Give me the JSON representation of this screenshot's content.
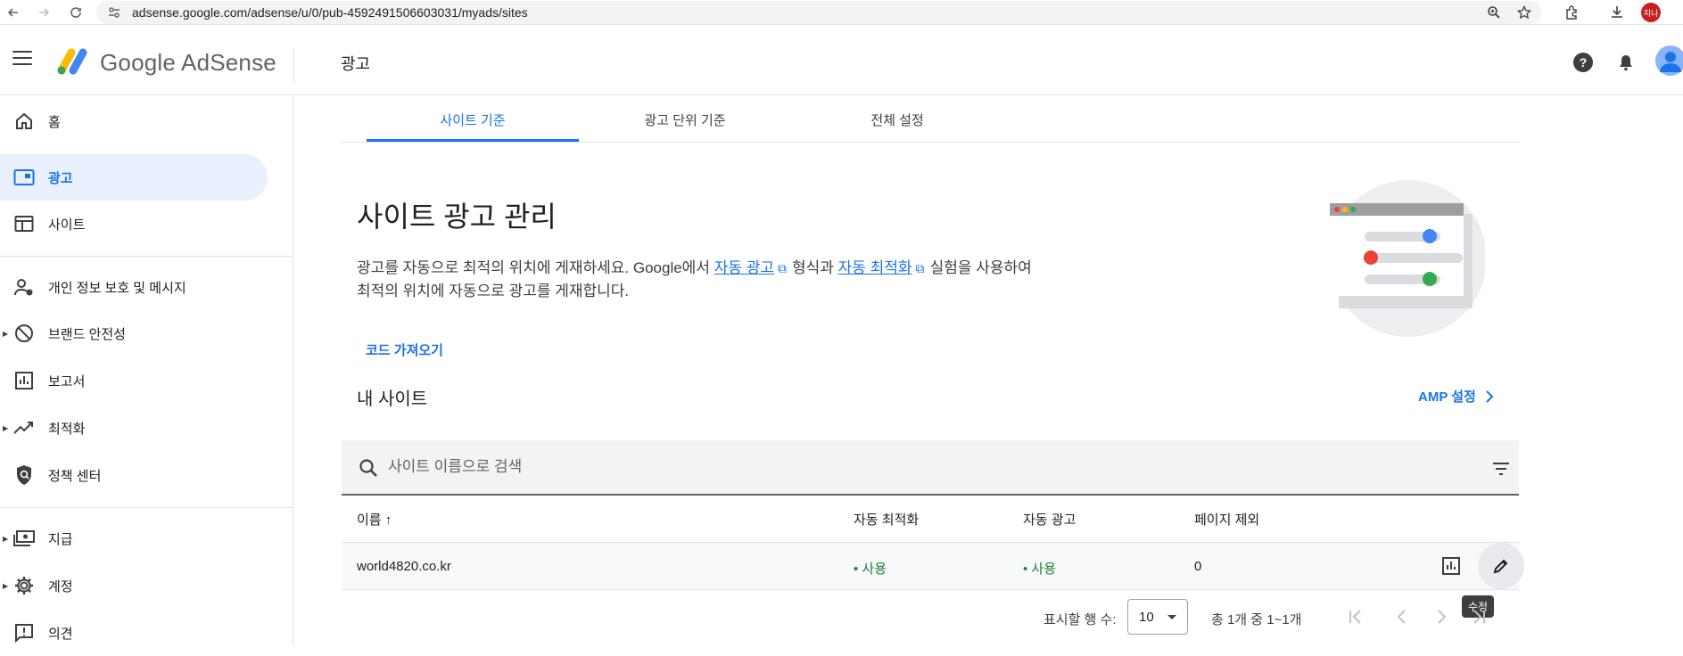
{
  "browser": {
    "url": "adsense.google.com/adsense/u/0/pub-4592491506603031/myads/sites",
    "profile_initials": "지나"
  },
  "header": {
    "product_name": "Google AdSense",
    "page_title": "광고"
  },
  "sidebar": {
    "items": [
      {
        "label": "홈",
        "icon": "home-icon"
      },
      {
        "label": "광고",
        "icon": "ads-icon",
        "active": true
      },
      {
        "label": "사이트",
        "icon": "sites-icon"
      },
      {
        "label": "개인 정보 보호 및 메시지",
        "icon": "privacy-messaging-icon"
      },
      {
        "label": "브랜드 안전성",
        "icon": "block-icon",
        "expandable": true
      },
      {
        "label": "보고서",
        "icon": "reports-icon"
      },
      {
        "label": "최적화",
        "icon": "trending-up-icon",
        "expandable": true
      },
      {
        "label": "정책 센터",
        "icon": "policy-shield-icon"
      },
      {
        "label": "지급",
        "icon": "payments-icon",
        "expandable": true
      },
      {
        "label": "계정",
        "icon": "settings-icon",
        "expandable": true
      },
      {
        "label": "의견",
        "icon": "feedback-icon"
      }
    ]
  },
  "tabs": [
    {
      "label": "사이트 기준",
      "active": true
    },
    {
      "label": "광고 단위 기준"
    },
    {
      "label": "전체 설정"
    }
  ],
  "hero": {
    "title": "사이트 광고 관리",
    "desc_part1": "광고를 자동으로 최적의 위치에 게재하세요. Google에서 ",
    "link_auto_ads": "자동 광고",
    "desc_part2": "형식과 ",
    "link_auto_opt": "자동 최적화",
    "desc_part3": "실험을 사용하여",
    "desc_line2": "최적의 위치에 자동으로 광고를 게재합니다.",
    "code_button": "코드 가져오기"
  },
  "sites": {
    "section_title": "내 사이트",
    "amp_link": "AMP 설정",
    "search_placeholder": "사이트 이름으로 검색",
    "columns": [
      "이름 ↑",
      "자동 최적화",
      "자동 광고",
      "페이지 제외"
    ],
    "rows": [
      {
        "name": "world4820.co.kr",
        "auto_optimization": "• 사용",
        "auto_ads": "• 사용",
        "excluded_pages": "0"
      }
    ],
    "edit_tooltip": "수정"
  },
  "pagination": {
    "rows_per_page_label": "표시할 행 수:",
    "rows_per_page_value": "10",
    "range_text": "총 1개 중 1~1개"
  },
  "colors": {
    "accent": "#1a73e8",
    "active_bg": "#e8f0fe",
    "status_green": "#188038"
  }
}
